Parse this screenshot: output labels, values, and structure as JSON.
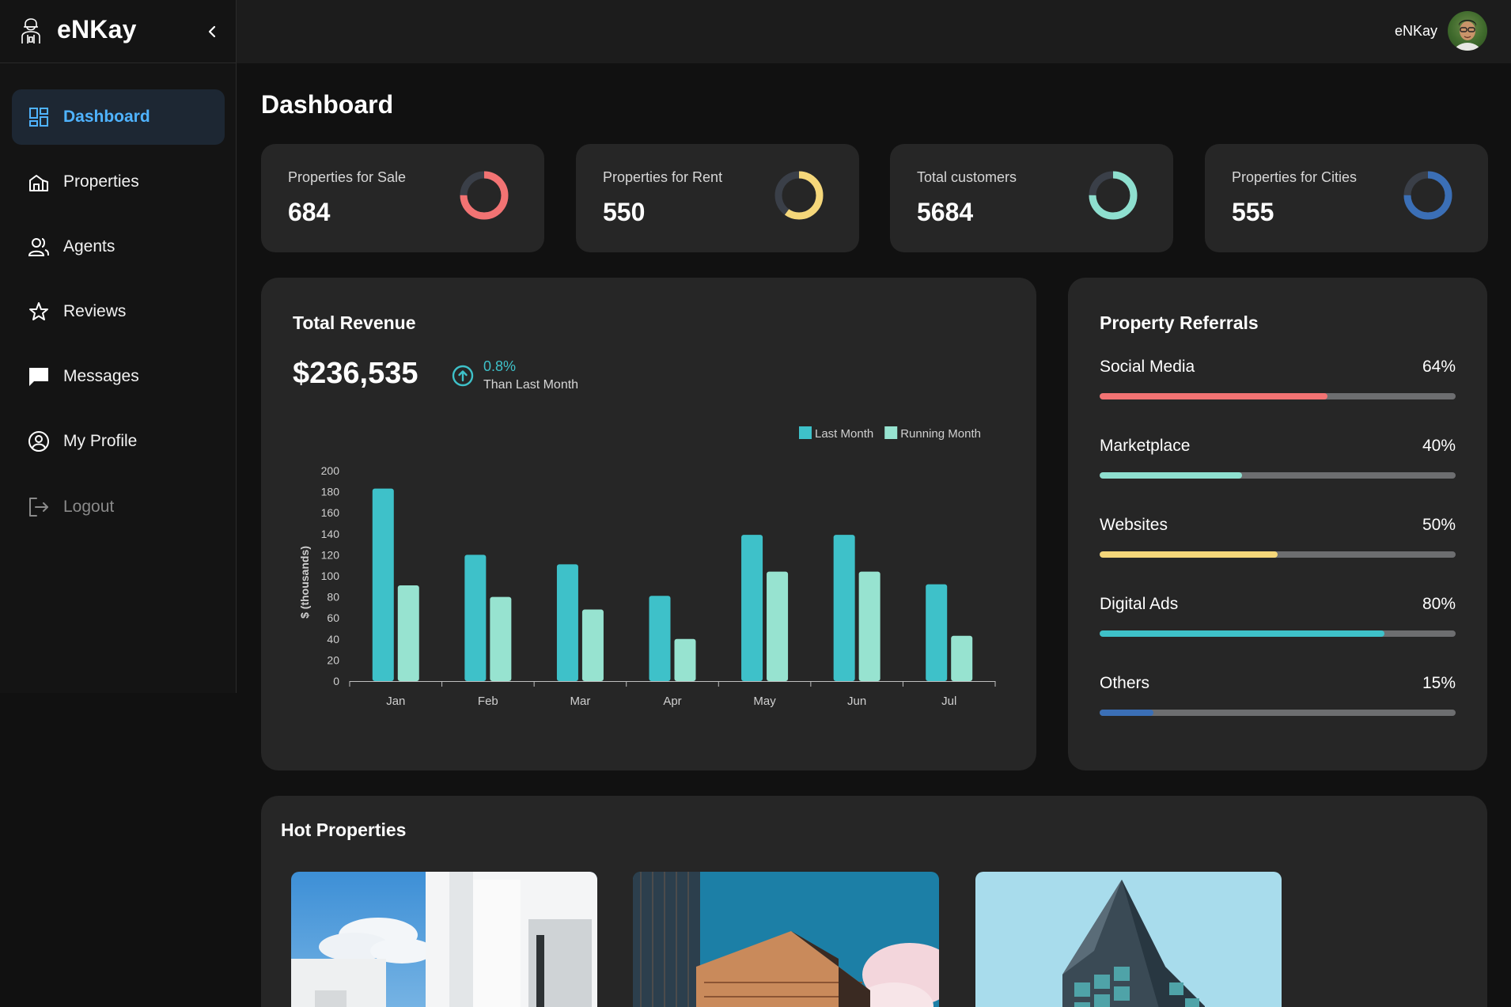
{
  "app": {
    "brand": "eNKay"
  },
  "header": {
    "user_name": "eNKay"
  },
  "sidebar": {
    "items": [
      {
        "label": "Dashboard",
        "icon": "dashboard-icon",
        "active": true
      },
      {
        "label": "Properties",
        "icon": "properties-icon"
      },
      {
        "label": "Agents",
        "icon": "agents-icon"
      },
      {
        "label": "Reviews",
        "icon": "star-icon"
      },
      {
        "label": "Messages",
        "icon": "message-icon"
      },
      {
        "label": "My Profile",
        "icon": "profile-icon"
      },
      {
        "label": "Logout",
        "icon": "logout-icon"
      }
    ]
  },
  "page": {
    "title": "Dashboard"
  },
  "stats": [
    {
      "label": "Properties for Sale",
      "value": "684",
      "ring_color": "#f27373",
      "ring_fraction": 0.75
    },
    {
      "label": "Properties for Rent",
      "value": "550",
      "ring_color": "#f5d77a",
      "ring_fraction": 0.6
    },
    {
      "label": "Total customers",
      "value": "5684",
      "ring_color": "#8edfcf",
      "ring_fraction": 0.75
    },
    {
      "label": "Properties for Cities",
      "value": "555",
      "ring_color": "#3b6fb6",
      "ring_fraction": 0.75
    }
  ],
  "revenue": {
    "title": "Total Revenue",
    "value": "$236,535",
    "trend_pct": "0.8%",
    "trend_text": "Than Last Month"
  },
  "chart_data": {
    "type": "bar",
    "categories": [
      "Jan",
      "Feb",
      "Mar",
      "Apr",
      "May",
      "Jun",
      "Jul"
    ],
    "series": [
      {
        "name": "Last Month",
        "color": "#3ec1c9",
        "values": [
          183,
          120,
          111,
          81,
          139,
          139,
          92
        ]
      },
      {
        "name": "Running Month",
        "color": "#97e3d0",
        "values": [
          91,
          80,
          68,
          40,
          104,
          104,
          43
        ]
      }
    ],
    "ylabel": "$ (thousands)",
    "ylim": [
      0,
      200
    ],
    "yticks": [
      0,
      20,
      40,
      60,
      80,
      100,
      120,
      140,
      160,
      180,
      200
    ],
    "legend": "top-right",
    "grid": false
  },
  "referrals": {
    "title": "Property Referrals",
    "items": [
      {
        "label": "Social Media",
        "pct": "64%",
        "value": 0.64,
        "color": "#f27373"
      },
      {
        "label": "Marketplace",
        "pct": "40%",
        "value": 0.4,
        "color": "#8edfcf"
      },
      {
        "label": "Websites",
        "pct": "50%",
        "value": 0.5,
        "color": "#f5d77a"
      },
      {
        "label": "Digital Ads",
        "pct": "80%",
        "value": 0.8,
        "color": "#3ec1c9"
      },
      {
        "label": "Others",
        "pct": "15%",
        "value": 0.15,
        "color": "#3b6fb6"
      }
    ]
  },
  "hot": {
    "title": "Hot Properties"
  }
}
